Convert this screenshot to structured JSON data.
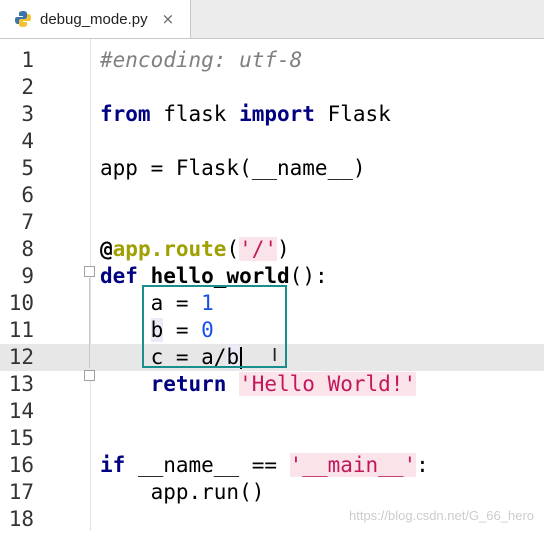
{
  "tab": {
    "label": "debug_mode.py",
    "close_glyph": "×",
    "icon": "python-file-icon"
  },
  "editor": {
    "current_line": 12,
    "lines": [
      {
        "n": "1",
        "tokens": [
          {
            "t": "#encoding: utf-8",
            "c": "cm"
          }
        ]
      },
      {
        "n": "2",
        "tokens": []
      },
      {
        "n": "3",
        "tokens": [
          {
            "t": "from",
            "c": "kw"
          },
          {
            "t": " flask ",
            "c": ""
          },
          {
            "t": "import",
            "c": "kw"
          },
          {
            "t": " Flask",
            "c": ""
          }
        ]
      },
      {
        "n": "4",
        "tokens": []
      },
      {
        "n": "5",
        "tokens": [
          {
            "t": "app = Flask(__name__)",
            "c": ""
          }
        ]
      },
      {
        "n": "6",
        "tokens": []
      },
      {
        "n": "7",
        "tokens": []
      },
      {
        "n": "8",
        "tokens": [
          {
            "t": "@",
            "c": "deco"
          },
          {
            "t": "app.route",
            "c": "deco-at"
          },
          {
            "t": "(",
            "c": ""
          },
          {
            "t": "'/'",
            "c": "str"
          },
          {
            "t": ")",
            "c": ""
          }
        ]
      },
      {
        "n": "9",
        "tokens": [
          {
            "t": "def",
            "c": "kw"
          },
          {
            "t": " ",
            "c": ""
          },
          {
            "t": "hello_world",
            "c": "fn"
          },
          {
            "t": "():",
            "c": ""
          }
        ]
      },
      {
        "n": "10",
        "tokens": [
          {
            "t": "    a = ",
            "c": ""
          },
          {
            "t": "1",
            "c": "num"
          }
        ]
      },
      {
        "n": "11",
        "tokens": [
          {
            "t": "    ",
            "c": ""
          },
          {
            "t": "b",
            "c": "var-hl"
          },
          {
            "t": " = ",
            "c": ""
          },
          {
            "t": "0",
            "c": "num"
          }
        ]
      },
      {
        "n": "12",
        "tokens": [
          {
            "t": "    c = a/",
            "c": ""
          },
          {
            "t": "b",
            "c": "var-hl"
          }
        ]
      },
      {
        "n": "13",
        "tokens": [
          {
            "t": "    ",
            "c": ""
          },
          {
            "t": "return",
            "c": "kw"
          },
          {
            "t": " ",
            "c": ""
          },
          {
            "t": "'Hello World!'",
            "c": "str"
          }
        ]
      },
      {
        "n": "14",
        "tokens": []
      },
      {
        "n": "15",
        "tokens": []
      },
      {
        "n": "16",
        "tokens": [
          {
            "t": "if",
            "c": "kw"
          },
          {
            "t": " __name__ == ",
            "c": ""
          },
          {
            "t": "'__main__'",
            "c": "str"
          },
          {
            "t": ":",
            "c": ""
          }
        ]
      },
      {
        "n": "17",
        "tokens": [
          {
            "t": "    app.run()",
            "c": ""
          }
        ]
      },
      {
        "n": "18",
        "tokens": []
      }
    ]
  },
  "watermark": "https://blog.csdn.net/G_66_hero",
  "colors": {
    "keyword": "#000080",
    "string": "#c2185b",
    "number": "#1750eb",
    "comment": "#808080",
    "highlight_box": "#1a8d8d"
  }
}
